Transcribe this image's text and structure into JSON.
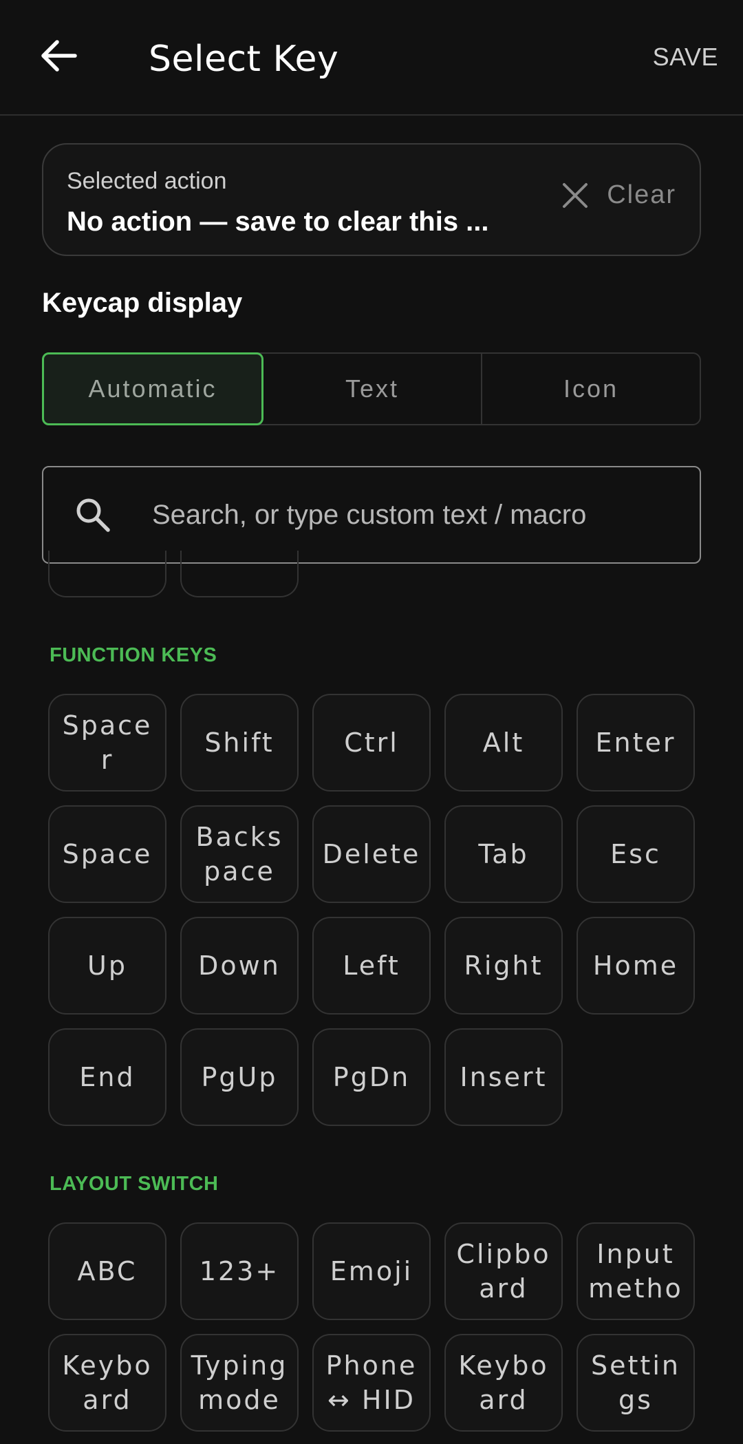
{
  "appbar": {
    "title": "Select Key",
    "save_label": "SAVE",
    "back_icon": "arrow-left-icon"
  },
  "selected_action": {
    "label": "Selected action",
    "value": "No action — save to clear this ...",
    "clear_label": "Clear",
    "clear_icon": "close-icon"
  },
  "keycap_display": {
    "heading": "Keycap display",
    "options": [
      "Automatic",
      "Text",
      "Icon"
    ],
    "selected": "Automatic"
  },
  "search": {
    "placeholder": "Search, or type custom text / macro",
    "value": ""
  },
  "function_keys": {
    "title": "FUNCTION KEYS",
    "keys": [
      "Space\nr",
      "Shift",
      "Ctrl",
      "Alt",
      "Enter",
      "Space",
      "Backs\npace",
      "Delete",
      "Tab",
      "Esc",
      "Up",
      "Down",
      "Left",
      "Right",
      "Home",
      "End",
      "PgUp",
      "PgDn",
      "Insert"
    ]
  },
  "layout_switch": {
    "title": "LAYOUT SWITCH",
    "keys": [
      "ABC",
      "123+",
      "Emoji",
      "Clipbo\nard",
      "Input\nmetho",
      "Keybo\nard",
      "Typing\nmode",
      "Phone\n↔ HID",
      "Keybo\nard",
      "Settin\ngs"
    ]
  },
  "colors": {
    "accent": "#4cbb55",
    "background": "#111111",
    "border": "#333333"
  }
}
